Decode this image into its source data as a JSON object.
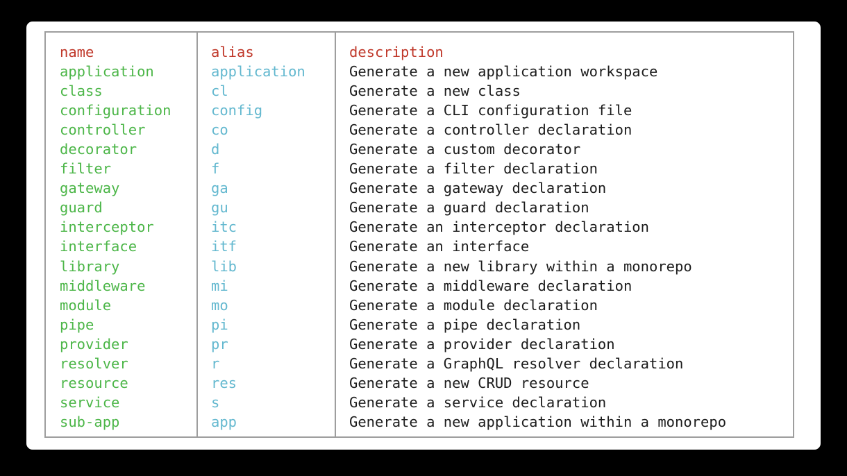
{
  "theme": {
    "background": "#000000",
    "card_background": "#ffffff",
    "border": "#9e9e9e",
    "header_color": "#c0392b",
    "name_color": "#4cb648",
    "alias_color": "#63b8cf",
    "description_color": "#1c1c1c"
  },
  "table": {
    "headers": {
      "name": "name",
      "alias": "alias",
      "description": "description"
    },
    "rows": [
      {
        "name": "application",
        "alias": "application",
        "description": "Generate a new application workspace"
      },
      {
        "name": "class",
        "alias": "cl",
        "description": "Generate a new class"
      },
      {
        "name": "configuration",
        "alias": "config",
        "description": "Generate a CLI configuration file"
      },
      {
        "name": "controller",
        "alias": "co",
        "description": "Generate a controller declaration"
      },
      {
        "name": "decorator",
        "alias": "d",
        "description": "Generate a custom decorator"
      },
      {
        "name": "filter",
        "alias": "f",
        "description": "Generate a filter declaration"
      },
      {
        "name": "gateway",
        "alias": "ga",
        "description": "Generate a gateway declaration"
      },
      {
        "name": "guard",
        "alias": "gu",
        "description": "Generate a guard declaration"
      },
      {
        "name": "interceptor",
        "alias": "itc",
        "description": "Generate an interceptor declaration"
      },
      {
        "name": "interface",
        "alias": "itf",
        "description": "Generate an interface"
      },
      {
        "name": "library",
        "alias": "lib",
        "description": "Generate a new library within a monorepo"
      },
      {
        "name": "middleware",
        "alias": "mi",
        "description": "Generate a middleware declaration"
      },
      {
        "name": "module",
        "alias": "mo",
        "description": "Generate a module declaration"
      },
      {
        "name": "pipe",
        "alias": "pi",
        "description": "Generate a pipe declaration"
      },
      {
        "name": "provider",
        "alias": "pr",
        "description": "Generate a provider declaration"
      },
      {
        "name": "resolver",
        "alias": "r",
        "description": "Generate a GraphQL resolver declaration"
      },
      {
        "name": "resource",
        "alias": "res",
        "description": "Generate a new CRUD resource"
      },
      {
        "name": "service",
        "alias": "s",
        "description": "Generate a service declaration"
      },
      {
        "name": "sub-app",
        "alias": "app",
        "description": "Generate a new application within a monorepo"
      }
    ]
  }
}
